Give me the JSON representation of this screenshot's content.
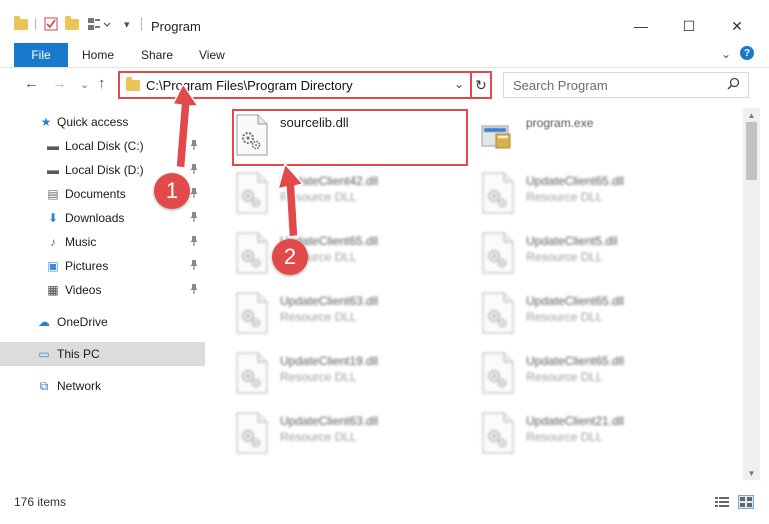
{
  "window": {
    "title": "Program",
    "minimize_glyph": "—",
    "maximize_glyph": "☐",
    "close_glyph": "✕"
  },
  "ribbon": {
    "tabs": [
      {
        "label": "File",
        "active": true
      },
      {
        "label": "Home"
      },
      {
        "label": "Share"
      },
      {
        "label": "View"
      }
    ],
    "expand_glyph": "⌄",
    "help_glyph": "?"
  },
  "address_bar": {
    "path": "C:\\Program Files\\Program Directory",
    "chevron_glyph": "⌄",
    "refresh_glyph": "↻",
    "back_glyph": "←",
    "forward_glyph": "→",
    "recent_glyph": "⌄",
    "up_glyph": "↑"
  },
  "search": {
    "placeholder": "Search Program",
    "icon_glyph": "⚲"
  },
  "sidebar": {
    "items": [
      {
        "label": "Quick access",
        "icon": "star-icon",
        "glyph": "★",
        "color": "#2f7fd0"
      },
      {
        "label": "Local Disk (C:)",
        "icon": "drive-icon",
        "glyph": "▬",
        "color": "#5a5a5a",
        "pinned": true
      },
      {
        "label": "Local Disk (D:)",
        "icon": "drive-icon",
        "glyph": "▬",
        "color": "#5a5a5a",
        "pinned": true
      },
      {
        "label": "Documents",
        "icon": "documents-icon",
        "glyph": "▤",
        "color": "#6b6b6b",
        "pinned": true
      },
      {
        "label": "Downloads",
        "icon": "download-icon",
        "glyph": "⬇",
        "color": "#2f7fd0",
        "pinned": true
      },
      {
        "label": "Music",
        "icon": "music-icon",
        "glyph": "♪",
        "color": "#2f7fd0",
        "pinned": true
      },
      {
        "label": "Pictures",
        "icon": "pictures-icon",
        "glyph": "▣",
        "color": "#3a8ad8",
        "pinned": true
      },
      {
        "label": "Videos",
        "icon": "video-icon",
        "glyph": "▦",
        "color": "#444",
        "pinned": true
      },
      {
        "label": "OneDrive",
        "icon": "cloud-icon",
        "glyph": "☁",
        "color": "#2f7fd0"
      },
      {
        "label": "This PC",
        "icon": "computer-icon",
        "glyph": "▭",
        "color": "#3a8ad8"
      },
      {
        "label": "Network",
        "icon": "network-icon",
        "glyph": "⧉",
        "color": "#2f7fd0"
      }
    ],
    "pin_glyph": "📌"
  },
  "files": [
    {
      "name": "sourcelib.dll",
      "sub": "",
      "type": "dll",
      "highlighted": true
    },
    {
      "name": "program.exe",
      "sub": "",
      "type": "exe"
    },
    {
      "name": "UpdateClient42.dll",
      "sub": "Resource DLL",
      "type": "dll"
    },
    {
      "name": "UpdateClient65.dll",
      "sub": "Resource DLL",
      "type": "dll"
    },
    {
      "name": "UpdateClient65.dll",
      "sub": "Resource DLL",
      "type": "dll"
    },
    {
      "name": "UpdateClient5.dll",
      "sub": "Resource DLL",
      "type": "dll"
    },
    {
      "name": "UpdateClient63.dll",
      "sub": "Resource DLL",
      "type": "dll"
    },
    {
      "name": "UpdateClient65.dll",
      "sub": "Resource DLL",
      "type": "dll"
    },
    {
      "name": "UpdateClient19.dll",
      "sub": "Resource DLL",
      "type": "dll"
    },
    {
      "name": "UpdateClient65.dll",
      "sub": "Resource DLL",
      "type": "dll"
    },
    {
      "name": "UpdateClient63.dll",
      "sub": "Resource DLL",
      "type": "dll"
    },
    {
      "name": "UpdateClient21.dll",
      "sub": "Resource DLL",
      "type": "dll"
    }
  ],
  "status": {
    "item_count": "176 items"
  },
  "annotations": [
    {
      "number": "1"
    },
    {
      "number": "2"
    }
  ],
  "colors": {
    "accent": "#1979ca",
    "highlight": "#e04a4a",
    "folder": "#e9c458",
    "selected_bg": "#dcdcdc"
  }
}
